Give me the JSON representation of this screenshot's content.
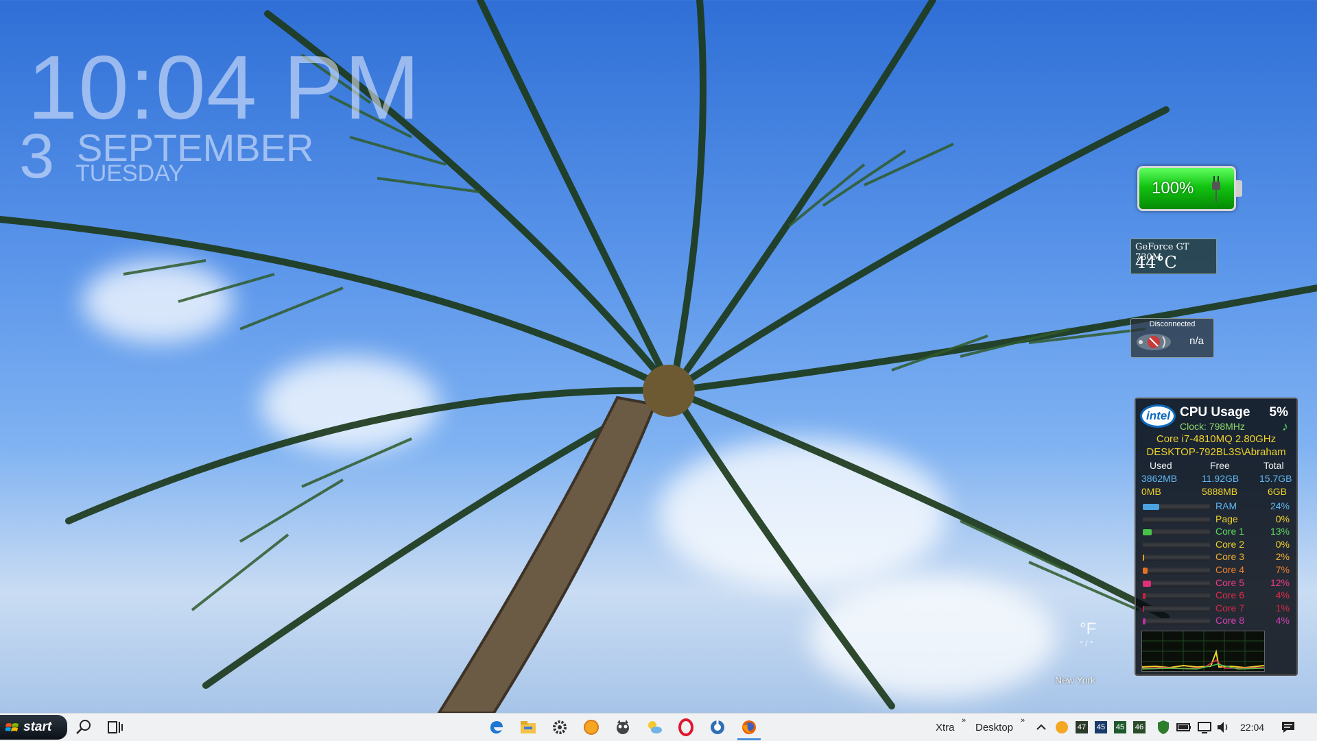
{
  "clock": {
    "time": "10:04 PM",
    "day": "3",
    "month": "SEPTEMBER",
    "weekday": "TUESDAY"
  },
  "battery": {
    "percent_label": "100%",
    "level": 1.0,
    "color": "#12c412"
  },
  "gpu": {
    "name": "GeForce GT 730M",
    "temp": "44°C"
  },
  "network": {
    "status": "Disconnected",
    "value": "n/a"
  },
  "cpu": {
    "logo": "intel",
    "title": "CPU Usage",
    "percent": "5%",
    "clock": "Clock:  798MHz",
    "model": "Core i7-4810MQ 2.80GHz",
    "host": "DESKTOP-792BL3S\\Abraham",
    "headers": [
      "Used",
      "Free",
      "Total"
    ],
    "ram_row": [
      "3862MB",
      "11.92GB",
      "15.7GB"
    ],
    "page_row": [
      "0MB",
      "5888MB",
      "6GB"
    ],
    "bars": [
      {
        "label": "RAM",
        "value": "24%",
        "level": 0.24,
        "color": "#4aa3e0",
        "text_color": "#5fb8f0"
      },
      {
        "label": "Page",
        "value": "0%",
        "level": 0.0,
        "color": "#e8d34a",
        "text_color": "#f0d22a"
      },
      {
        "label": "Core 1",
        "value": "13%",
        "level": 0.13,
        "color": "#4ac24a",
        "text_color": "#5fd85f"
      },
      {
        "label": "Core 2",
        "value": "0%",
        "level": 0.0,
        "color": "#e8d34a",
        "text_color": "#f0d22a"
      },
      {
        "label": "Core 3",
        "value": "2%",
        "level": 0.02,
        "color": "#f0a020",
        "text_color": "#f0b030"
      },
      {
        "label": "Core 4",
        "value": "7%",
        "level": 0.07,
        "color": "#e87020",
        "text_color": "#f08030"
      },
      {
        "label": "Core 5",
        "value": "12%",
        "level": 0.12,
        "color": "#e0307a",
        "text_color": "#f03c80"
      },
      {
        "label": "Core 6",
        "value": "4%",
        "level": 0.04,
        "color": "#d02040",
        "text_color": "#e02a4a"
      },
      {
        "label": "Core 7",
        "value": "1%",
        "level": 0.01,
        "color": "#c02050",
        "text_color": "#d8284c"
      },
      {
        "label": "Core 8",
        "value": "4%",
        "level": 0.04,
        "color": "#c030a0",
        "text_color": "#d040b0"
      }
    ]
  },
  "weather": {
    "unit": "°F",
    "degree_line": "° / °",
    "city": "New York"
  },
  "taskbar": {
    "start_label": "start",
    "toolbar_xtra": "Xtra",
    "toolbar_desktop": "Desktop",
    "tray_numbers": [
      "47",
      "45",
      "45",
      "46"
    ],
    "time": "22:04",
    "icons": [
      "search-icon",
      "task-view-icon",
      "edge-icon",
      "file-explorer-icon",
      "settings-icon",
      "orange-app-icon",
      "cat-app-icon",
      "weather-app-icon",
      "opera-icon",
      "browser-app-icon",
      "firefox-icon"
    ]
  }
}
